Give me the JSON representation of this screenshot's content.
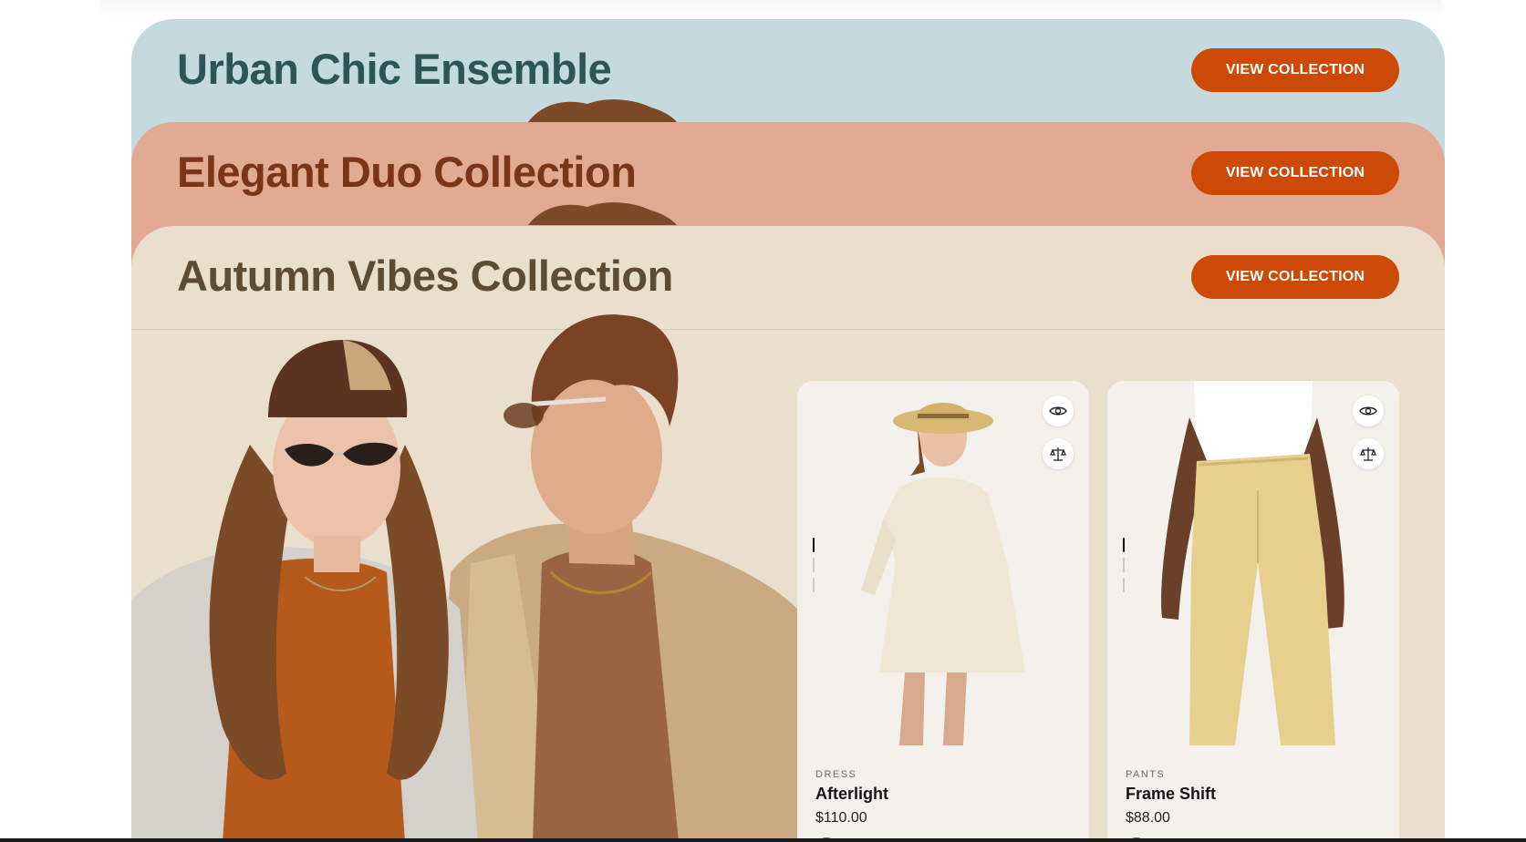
{
  "collections": [
    {
      "title": "Urban Chic Ensemble",
      "button": "VIEW COLLECTION",
      "bg": "#c5dadf",
      "text_color": "#2f5458"
    },
    {
      "title": "Elegant Duo Collection",
      "button": "VIEW COLLECTION",
      "bg": "#e2a993",
      "text_color": "#7a3417"
    },
    {
      "title": "Autumn Vibes Collection",
      "button": "VIEW COLLECTION",
      "bg": "#eadfcd",
      "text_color": "#5e4b34"
    }
  ],
  "products": [
    {
      "category": "DRESS",
      "name": "Afterlight",
      "price": "$110.00",
      "swatch": "#ead7a2"
    },
    {
      "category": "PANTS",
      "name": "Frame Shift",
      "price": "$88.00",
      "swatch": "#ead7a2"
    }
  ],
  "colors": {
    "accent": "#cc4a06",
    "card_bg": "#f4f1ed"
  },
  "icons": [
    "quick-view-eye-icon",
    "compare-scale-icon"
  ]
}
